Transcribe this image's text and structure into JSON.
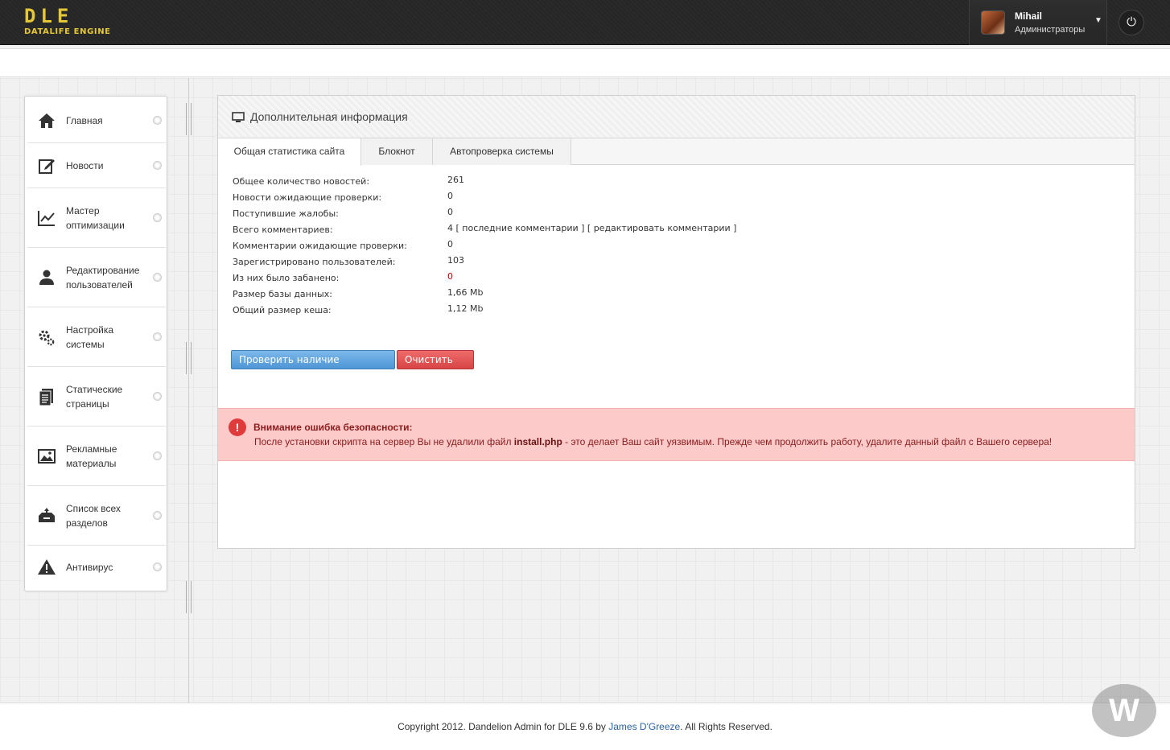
{
  "header": {
    "logo_main": "DLE",
    "logo_sub": "DATALIFE ENGINE",
    "user_name": "Mihail",
    "user_role": "Администраторы",
    "caret": "▼",
    "power_icon": "⏻"
  },
  "sidebar": {
    "items": [
      {
        "label": "Главная",
        "icon": "home-icon"
      },
      {
        "label": "Новости",
        "icon": "edit-icon"
      },
      {
        "label": "Мастер оптимизации",
        "icon": "chart-line-icon"
      },
      {
        "label": "Редактирование пользователей",
        "icon": "user-icon"
      },
      {
        "label": "Настройка системы",
        "icon": "gears-icon"
      },
      {
        "label": "Статические страницы",
        "icon": "pages-icon"
      },
      {
        "label": "Рекламные материалы",
        "icon": "image-icon"
      },
      {
        "label": "Список всех разделов",
        "icon": "categories-icon"
      },
      {
        "label": "Антивирус",
        "icon": "warning-icon"
      }
    ]
  },
  "panel": {
    "title": "Дополнительная информация",
    "tabs": [
      "Общая статистика сайта",
      "Блокнот",
      "Автопроверка системы"
    ],
    "stats": [
      {
        "label": "Общее количество новостей:",
        "value": "261"
      },
      {
        "label": "Новости ожидающие проверки:",
        "value": "0"
      },
      {
        "label": "Поступившие жалобы:",
        "value": "0"
      },
      {
        "label": "Всего комментариев:",
        "value": "4 [ последние комментарии ] [ редактировать комментарии ]"
      },
      {
        "label": "Комментарии ожидающие проверки:",
        "value": "0"
      },
      {
        "label": "Зарегистрировано пользователей:",
        "value": "103"
      },
      {
        "label": "Из них было забанено:",
        "value": "0"
      },
      {
        "label": "Размер базы данных:",
        "value": "1,66 Mb"
      },
      {
        "label": "Общий размер кеша:",
        "value": "1,12 Mb"
      }
    ],
    "btn_update": "Проверить наличие обновлений",
    "btn_clear_cache": "Очистить кеш"
  },
  "alert": {
    "icon": "!",
    "title": "Внимание ошибка безопасности:",
    "text_before": "После установки скрипта на сервер Вы не удалили файл ",
    "file": "install.php",
    "text_after": " - это делает Ваш сайт уязвимым. Прежде чем продолжить работу, удалите данный файл с Вашего сервера!"
  },
  "footer": {
    "text_before": "Copyright 2012. Dandelion Admin for DLE 9.6 by ",
    "author": "James D'Greeze",
    "text_after": ". All Rights Reserved.",
    "watermark": "W"
  },
  "colors": {
    "logo": "#e5c73a",
    "button_blue": "#4f96d6",
    "button_red": "#d74545",
    "alert_bg": "#fdcaca",
    "alert_text": "#8b1c1c",
    "banned_value": "#cc0000"
  }
}
